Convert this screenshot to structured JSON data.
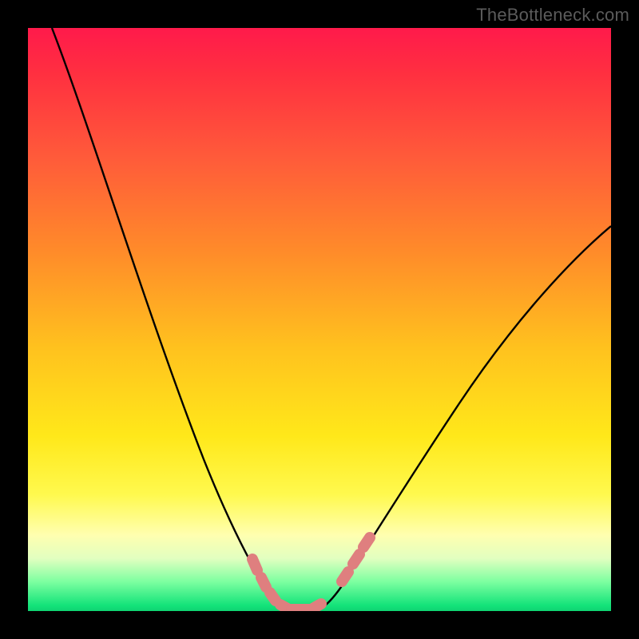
{
  "watermark": "TheBottleneck.com",
  "colors": {
    "frame": "#000000",
    "curve_stroke": "#000000",
    "marker_fill": "#e08080",
    "gradient_top": "#ff1a4b",
    "gradient_mid": "#ffe81a",
    "gradient_bottom": "#0fd472"
  },
  "chart_data": {
    "type": "line",
    "title": "",
    "xlabel": "",
    "ylabel": "",
    "xlim": [
      0,
      100
    ],
    "ylim": [
      0,
      100
    ],
    "grid": false,
    "series": [
      {
        "name": "curve",
        "x": [
          0,
          5,
          10,
          15,
          20,
          25,
          30,
          33,
          35,
          37,
          40,
          42,
          44,
          46,
          48,
          50,
          55,
          60,
          65,
          70,
          75,
          80,
          85,
          90,
          95,
          100
        ],
        "y": [
          100,
          88,
          76,
          64,
          52,
          40,
          27,
          18,
          12,
          7,
          3,
          1,
          0,
          0,
          1,
          3,
          11,
          20,
          28,
          35,
          42,
          48,
          53,
          58,
          62,
          66
        ]
      }
    ],
    "markers": {
      "name": "highlighted-range",
      "x": [
        37.5,
        39,
        41,
        43,
        45,
        47,
        49,
        50,
        51,
        52.5,
        54
      ],
      "y": [
        6,
        3.5,
        1.5,
        0.5,
        0,
        0.5,
        2,
        3,
        5,
        8,
        11
      ]
    }
  }
}
